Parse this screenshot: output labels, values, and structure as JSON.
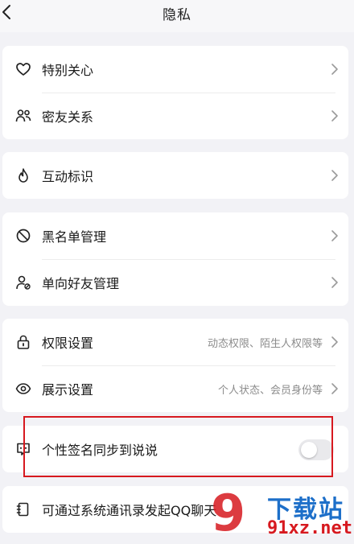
{
  "header": {
    "title": "隐私"
  },
  "sections": [
    {
      "items": [
        {
          "icon": "heart-icon",
          "label": "特别关心",
          "hint": ""
        },
        {
          "icon": "close-friends-icon",
          "label": "密友关系",
          "hint": ""
        }
      ]
    },
    {
      "items": [
        {
          "icon": "flame-icon",
          "label": "互动标识",
          "hint": ""
        }
      ]
    },
    {
      "items": [
        {
          "icon": "block-icon",
          "label": "黑名单管理",
          "hint": ""
        },
        {
          "icon": "one-way-friend-icon",
          "label": "单向好友管理",
          "hint": ""
        }
      ]
    },
    {
      "items": [
        {
          "icon": "lock-icon",
          "label": "权限设置",
          "hint": "动态权限、陌生人权限等"
        },
        {
          "icon": "eye-icon",
          "label": "展示设置",
          "hint": "个人状态、会员身份等"
        }
      ]
    },
    {
      "items": [
        {
          "icon": "signature-icon",
          "label": "个性签名同步到说说",
          "toggle_on": false
        }
      ]
    },
    {
      "items": [
        {
          "icon": "contacts-book-icon",
          "label": "可通过系统通讯录发起QQ聊天"
        }
      ]
    }
  ],
  "watermark": {
    "mark": "9",
    "brand": "下载站",
    "domain": "91xz.net"
  },
  "colors": {
    "highlight": "#d7191f",
    "watermark_blue": "#1d6fc9",
    "background": "#f2f2f6"
  }
}
